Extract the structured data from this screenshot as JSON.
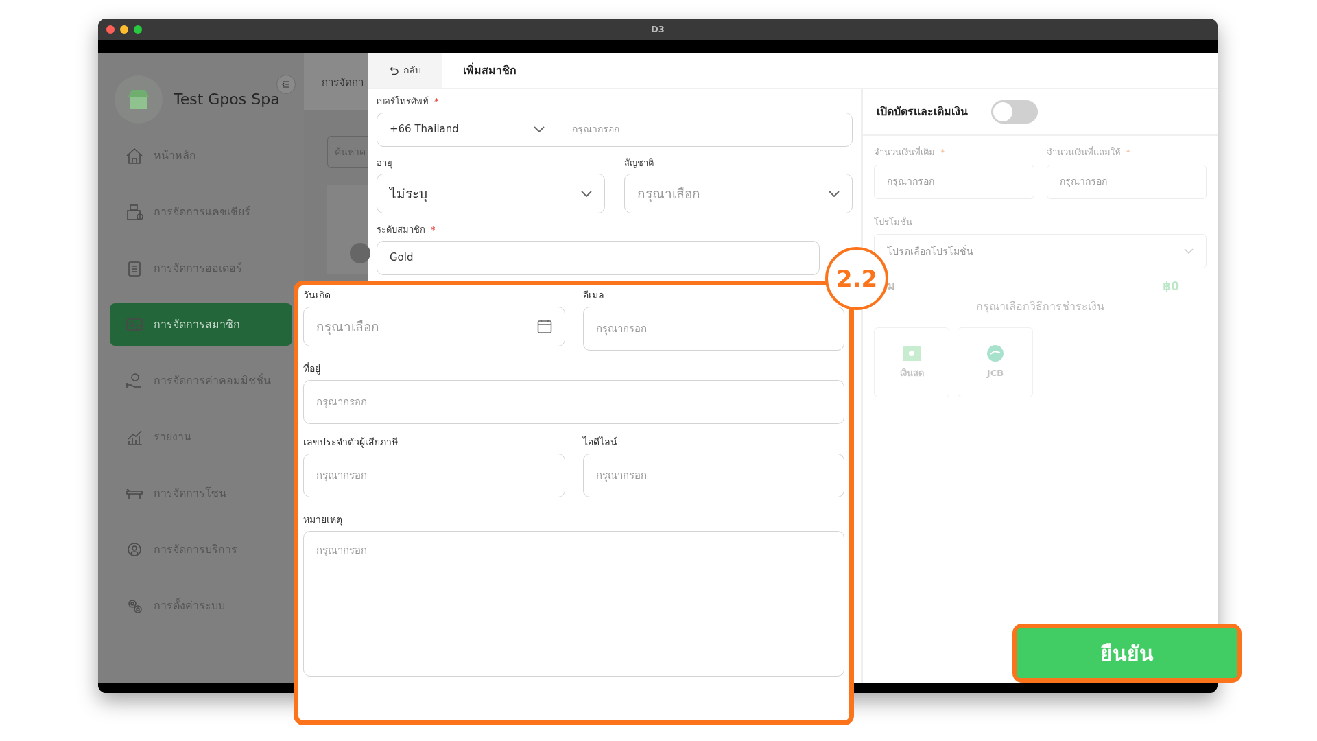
{
  "window": {
    "title": "D3"
  },
  "sidebar": {
    "brand": "Test Gpos Spa",
    "items": [
      {
        "label": "หน้าหลัก",
        "selected": false
      },
      {
        "label": "การจัดการแคชเชียร์",
        "selected": false
      },
      {
        "label": "การจัดการออเดอร์",
        "selected": false
      },
      {
        "label": "การจัดการสมาชิก",
        "selected": true
      },
      {
        "label": "การจัดการค่าคอมมิชชั่น",
        "selected": false
      },
      {
        "label": "รายงาน",
        "selected": false
      },
      {
        "label": "การจัดการโซน",
        "selected": false
      },
      {
        "label": "การจัดการบริการ",
        "selected": false
      },
      {
        "label": "การตั้งค่าระบบ",
        "selected": false
      }
    ]
  },
  "background_page": {
    "heading": "การจัดกา",
    "search_placeholder": "ค้นหาด"
  },
  "modal": {
    "back": "กลับ",
    "title": "เพิ่มสมาชิก",
    "rows": [
      [
        {
          "label": "เบอร์โทรศัพท์",
          "required_mark": "*",
          "kind": "phone",
          "value": "+66 Thailand",
          "placeholder": "กรุณากรอก"
        }
      ],
      [
        {
          "label": "อายุ",
          "kind": "select",
          "value": "ไม่ระบุ"
        },
        {
          "label": "สัญชาติ",
          "kind": "select",
          "placeholder": "กรุณาเลือก"
        }
      ],
      [
        {
          "label": "ระดับสมาชิก",
          "required_mark": "*",
          "kind": "text",
          "value": "Gold"
        }
      ]
    ],
    "highlighted_rows": [
      [
        {
          "label": "วันเกิด",
          "kind": "date",
          "placeholder": "กรุณาเลือก"
        },
        {
          "label": "อีเมล",
          "kind": "text",
          "placeholder": "กรุณากรอก"
        }
      ],
      [
        {
          "label": "ที่อยู่",
          "kind": "text",
          "placeholder": "กรุณากรอก"
        }
      ],
      [
        {
          "label": "เลขประจำตัวผู้เสียภาษี",
          "kind": "text",
          "placeholder": "กรุณากรอก"
        },
        {
          "label": "ไอดีไลน์",
          "kind": "text",
          "placeholder": "กรุณากรอก"
        }
      ],
      [
        {
          "label": "หมายเหตุ",
          "kind": "textarea",
          "placeholder": "กรุณากรอก"
        }
      ]
    ]
  },
  "topup": {
    "title": "เปิดบัตรและเติมเงิน",
    "on": false,
    "fields": [
      {
        "label": "จำนวนเงินที่เติม",
        "required_mark": "*",
        "placeholder": "กรุณากรอก"
      },
      {
        "label": "จำนวนเงินที่แถมให้",
        "required_mark": "*",
        "placeholder": "กรุณากรอก"
      }
    ],
    "promotion": {
      "label": "โปรโมชั่น",
      "placeholder": "โปรดเลือกโปรโมชั่น"
    },
    "total_label": "ม",
    "total_value": "฿0",
    "payment_prompt": "กรุณาเลือกวิธีการชำระเงิน",
    "payment_methods": [
      {
        "label": "เงินสด",
        "kind": "cash"
      },
      {
        "label": "JCB",
        "kind": "jcb"
      }
    ]
  },
  "confirm_button": "ยืนยัน",
  "callout": "2.2"
}
